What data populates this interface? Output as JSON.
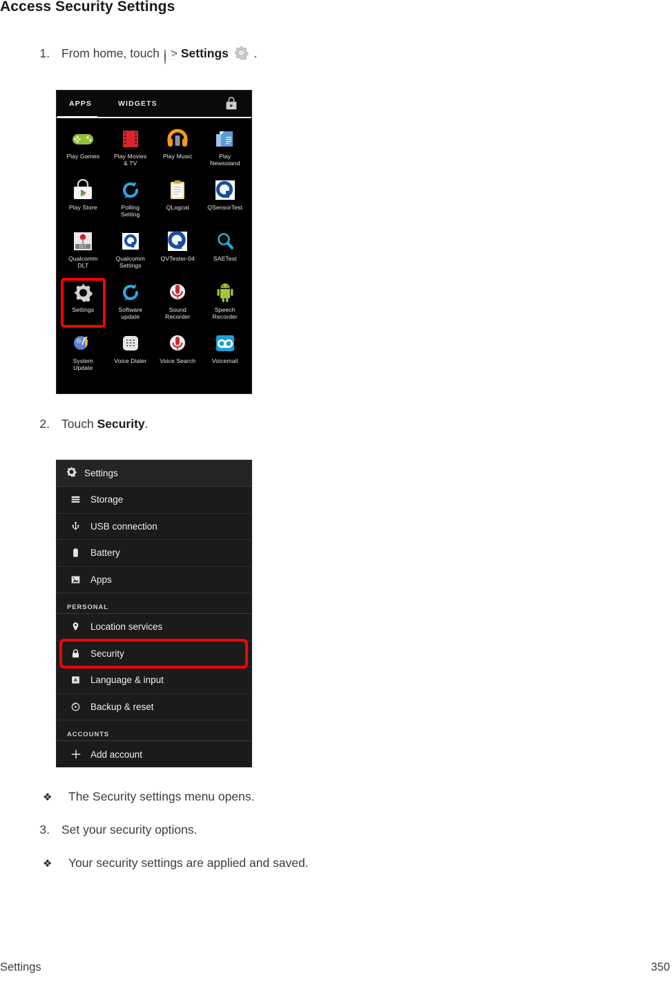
{
  "document": {
    "heading": "Access Security Settings",
    "footer_left": "Settings",
    "footer_page": "350"
  },
  "steps": [
    {
      "number": "1.",
      "text_before": "From home, touch",
      "icon_1": "apps-drawer-icon",
      "separator": ">",
      "bold_label": "Settings",
      "icon_2": "gear-icon",
      "text_after": "."
    },
    {
      "number": "2.",
      "text_before": "Touch",
      "bold_label": "Security",
      "text_after": "."
    },
    {
      "number": "3.",
      "text_before": "Set your security options.",
      "bold_label": "",
      "text_after": ""
    }
  ],
  "bullets": [
    {
      "glyph": "❖",
      "text": "The Security settings menu opens."
    },
    {
      "glyph": "❖",
      "text": "Your security settings are applied and saved."
    }
  ],
  "apps_screenshot": {
    "name": "android-apps-drawer-screenshot",
    "tabs": [
      {
        "label": "APPS",
        "selected": true
      },
      {
        "label": "WIDGETS",
        "selected": false
      }
    ],
    "store_icon": "play-store-bag-icon",
    "highlighted_app": "Settings",
    "apps": [
      {
        "label": "Play Games",
        "icon": "gamepad-icon"
      },
      {
        "label": "Play Movies\n& TV",
        "icon": "film-strip-icon"
      },
      {
        "label": "Play Music",
        "icon": "headphones-icon"
      },
      {
        "label": "Play\nNewsstand",
        "icon": "newsstand-icon"
      },
      {
        "label": "Play Store",
        "icon": "play-store-bag-icon"
      },
      {
        "label": "Polling\nSetting",
        "icon": "refresh-circle-icon"
      },
      {
        "label": "QLogcat",
        "icon": "clipboard-icon"
      },
      {
        "label": "QSensorTest",
        "icon": "qualcomm-q-icon"
      },
      {
        "label": "Qualcomm\nDLT",
        "icon": "qualcomm-dlt-icon"
      },
      {
        "label": "Qualcomm\nSettings",
        "icon": "qualcomm-q-icon"
      },
      {
        "label": "QVTester-04",
        "icon": "qualcomm-q-icon"
      },
      {
        "label": "SAETest",
        "icon": "magnifier-icon"
      },
      {
        "label": "Settings",
        "icon": "gear-icon"
      },
      {
        "label": "Software\nupdate",
        "icon": "refresh-circle-icon"
      },
      {
        "label": "Sound\nRecorder",
        "icon": "microphone-red-icon"
      },
      {
        "label": "Speech\nRecorder",
        "icon": "android-robot-icon"
      },
      {
        "label": "System\nUpdate",
        "icon": "tools-globe-icon"
      },
      {
        "label": "Voice Dialer",
        "icon": "keypad-icon"
      },
      {
        "label": "Voice Search",
        "icon": "microphone-red-icon"
      },
      {
        "label": "Voicemail",
        "icon": "voicemail-icon"
      }
    ]
  },
  "settings_screenshot": {
    "name": "android-settings-menu-screenshot",
    "header": {
      "title": "Settings",
      "icon": "gear-icon"
    },
    "highlighted_row": "Security",
    "rows": [
      {
        "type": "item",
        "label": "Storage",
        "icon": "storage-icon"
      },
      {
        "type": "item",
        "label": "USB connection",
        "icon": "usb-icon"
      },
      {
        "type": "item",
        "label": "Battery",
        "icon": "battery-icon"
      },
      {
        "type": "item",
        "label": "Apps",
        "icon": "apps-image-icon"
      },
      {
        "type": "section",
        "label": "PERSONAL",
        "icon": ""
      },
      {
        "type": "item",
        "label": "Location services",
        "icon": "location-pin-icon"
      },
      {
        "type": "item",
        "label": "Security",
        "icon": "lock-icon"
      },
      {
        "type": "item",
        "label": "Language & input",
        "icon": "language-a-icon"
      },
      {
        "type": "item",
        "label": "Backup & reset",
        "icon": "backup-reset-icon"
      },
      {
        "type": "section",
        "label": "ACCOUNTS",
        "icon": ""
      },
      {
        "type": "item",
        "label": "Add account",
        "icon": "plus-icon"
      }
    ]
  },
  "colors": {
    "highlight": "#ff0000",
    "screen_bg": "#000000",
    "settings_bg": "#1b1b1b",
    "text": "#3c3c3b"
  }
}
